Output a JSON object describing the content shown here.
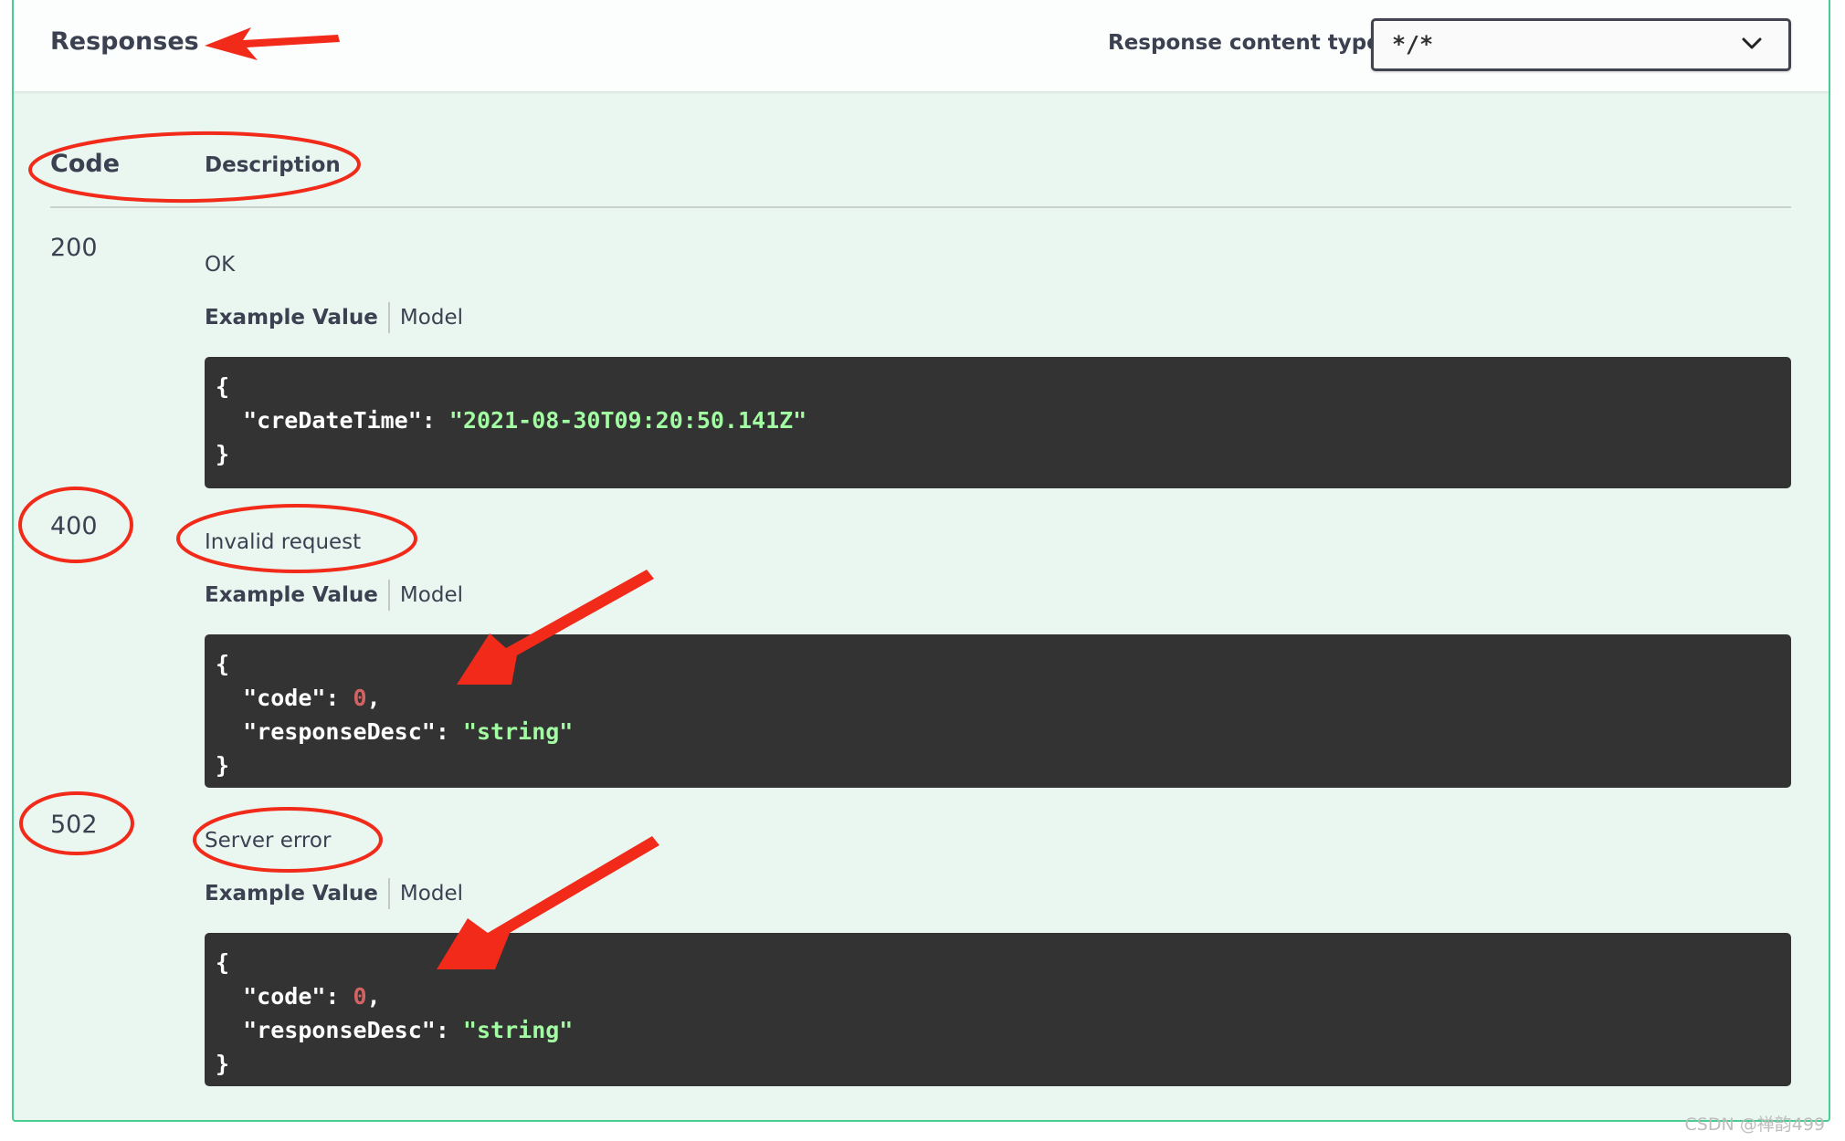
{
  "header": {
    "title": "Responses",
    "content_type_label": "Response content type",
    "content_type_value": "*/*"
  },
  "table": {
    "code_header": "Code",
    "description_header": "Description"
  },
  "responses": [
    {
      "code": "200",
      "description": "OK",
      "tab_example": "Example Value",
      "tab_model": "Model",
      "example": {
        "open": "{",
        "close": "}",
        "k1": "\"creDateTime\"",
        "v1": "\"2021-08-30T09:20:50.141Z\""
      }
    },
    {
      "code": "400",
      "description": "Invalid request",
      "tab_example": "Example Value",
      "tab_model": "Model",
      "example": {
        "open": "{",
        "close": "}",
        "k1": "\"code\"",
        "v1": "0",
        "k2": "\"responseDesc\"",
        "v2": "\"string\""
      }
    },
    {
      "code": "502",
      "description": "Server error",
      "tab_example": "Example Value",
      "tab_model": "Model",
      "example": {
        "open": "{",
        "close": "}",
        "k1": "\"code\"",
        "v1": "0",
        "k2": "\"responseDesc\"",
        "v2": "\"string\""
      }
    }
  ],
  "watermark": "CSDN @禅韵499",
  "colors": {
    "accent": "#49cc90",
    "panel_bg": "#eaf7f1",
    "code_bg": "#333333",
    "string": "#a2fca2",
    "number": "#d36363",
    "annotation": "#f22a19"
  },
  "icons": {
    "select_caret": "chevron-down-icon"
  }
}
